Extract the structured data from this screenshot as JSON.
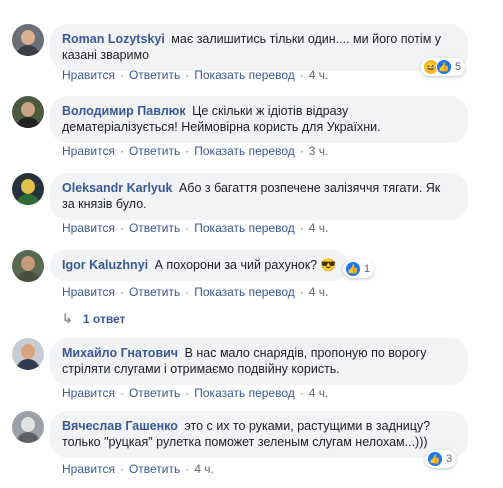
{
  "action_labels": {
    "like": "Нравится",
    "reply": "Ответить",
    "translate": "Показать перевод"
  },
  "comments": [
    {
      "author": "Roman Lozytskyi",
      "text": "має залишитись тільки один.... ми його потім у казані зваримо",
      "time": "4 ч.",
      "reaction_count": "5",
      "avatar_colors": {
        "bg": "#6b6f76",
        "face": "#d8b08c",
        "body": "#3b3f45"
      }
    },
    {
      "author": "Володимир Павлюк",
      "text": "Це скільки ж ідіотів відразу дематеріалізується! Неймовірна користь для Україхни.",
      "time": "3 ч.",
      "avatar_colors": {
        "bg": "#4d5a42",
        "face": "#c9a183",
        "body": "#232323"
      }
    },
    {
      "author": "Oleksandr Karlyuk",
      "text": "Або з багаття розпечене залізяччя тягати. Як за князів було.",
      "time": "4 ч.",
      "avatar_colors": {
        "bg": "#27323c",
        "face": "#e0c14a",
        "body": "#2f6b32"
      }
    },
    {
      "author": "Igor Kaluzhnyi",
      "text": "А похорони за чий рахунок?",
      "time": "4 ч.",
      "reaction_count": "1",
      "emoji": "😎",
      "replies_label": "1 ответ",
      "avatar_colors": {
        "bg": "#5a6a52",
        "face": "#c79a7a",
        "body": "#4a4f3a"
      }
    },
    {
      "author": "Михайло Гнатович",
      "text": "В нас мало снарядів, пропоную по ворогу стріляти слугами і отримаємо подвійну користь.",
      "time": "4 ч.",
      "avatar_colors": {
        "bg": "#c8ccd2",
        "face": "#d6a57e",
        "body": "#2e3b52"
      }
    },
    {
      "author": "Вячеслав Гашенко",
      "text": "это с их то руками, растущими в задницу? только \"руцкая\" рулетка поможет зеленым слугам нелохам...)))",
      "time": "4 ч.",
      "reaction_count": "3",
      "avatar_colors": {
        "bg": "#9aa0a6",
        "face": "#e3e3e3",
        "body": "#5e6166"
      }
    }
  ]
}
